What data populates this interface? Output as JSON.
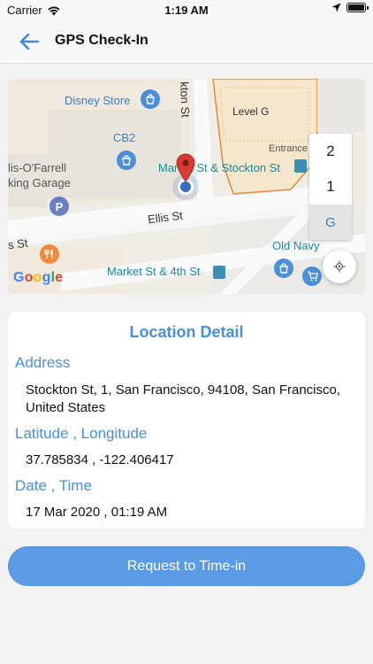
{
  "status_bar": {
    "carrier": "Carrier",
    "time": "1:19 AM",
    "battery_level": 1.0
  },
  "nav": {
    "title": "GPS Check-In",
    "back_icon": "arrow-left-icon"
  },
  "map": {
    "labels": {
      "disney_store": "Disney Store",
      "stockton_st": "kton St",
      "level_g": "Level G",
      "cb2": "CB2",
      "entrance": "Entrance /",
      "ofarrell_1": "lis-O'Farrell",
      "ofarrell_2": "king Garage",
      "market_stockton": "Market St & Stockton St",
      "ellis_st": "Ellis St",
      "s_st": "s St",
      "old_navy": "Old Navy",
      "market_4th": "Market St & 4th St"
    },
    "floors": [
      "2",
      "1",
      "G"
    ],
    "active_floor": "G",
    "attribution": "Google"
  },
  "detail": {
    "title": "Location Detail",
    "address_label": "Address",
    "address_value": "Stockton St, 1, San Francisco, 94108, San Francisco, United States",
    "latlng_label": "Latitude , Longitude",
    "latlng_value": "37.785834 , -122.406417",
    "datetime_label": "Date , Time",
    "datetime_value": "17 Mar 2020 , 01:19 AM"
  },
  "request_button": "Request to Time-in",
  "colors": {
    "accent": "#4a8fd8",
    "button": "#5b9be6",
    "pin": "#d93a32"
  }
}
